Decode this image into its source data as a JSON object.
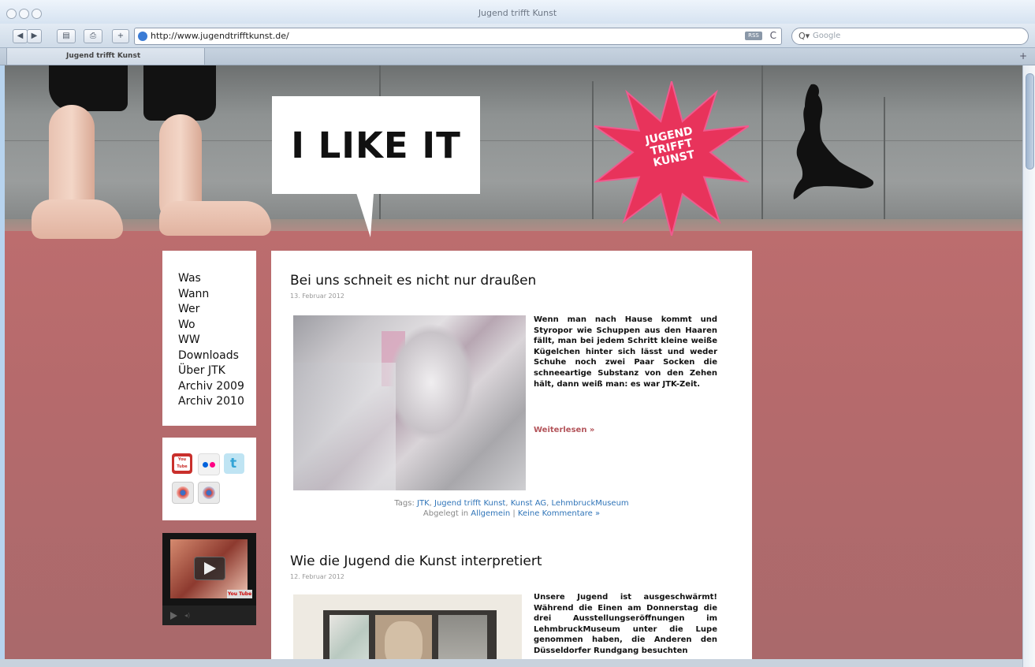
{
  "window": {
    "title": "Jugend trifft Kunst"
  },
  "toolbar": {
    "back_label": "◀",
    "forward_label": "▶",
    "url": "http://www.jugendtrifftkunst.de/",
    "rss_label": "RSS",
    "reload_label": "C",
    "search_placeholder": "Google",
    "search_prefix": "Q▾"
  },
  "tab": {
    "label": "Jugend trifft Kunst"
  },
  "header": {
    "bubble_text": "I LIKE IT",
    "star_lines": [
      "JUGEND",
      "TRIFFT",
      "KUNST"
    ]
  },
  "nav": {
    "items": [
      "Was",
      "Wann",
      "Wer",
      "Wo",
      "WW",
      "Downloads",
      "Über JTK",
      "Archiv 2009",
      "Archiv 2010"
    ]
  },
  "social": {
    "icons": [
      "youtube-icon",
      "flickr-icon",
      "twitter-icon",
      "badge-icon",
      "badge-icon"
    ],
    "youtube_label": "You Tube"
  },
  "video": {
    "label": "You Tube"
  },
  "posts": [
    {
      "title": "Bei uns schneit es nicht nur draußen",
      "date": "13. Februar 2012",
      "text": "Wenn man nach Hause kommt und Styropor wie Schuppen aus den Haaren fällt, man bei jedem Schritt kleine weiße Kügelchen hinter sich lässt und weder Schuhe noch zwei Paar Socken die schneeartige Substanz von den Zehen hält, dann weiß man: es war JTK-Zeit.",
      "more": "Weiterlesen »",
      "tags_label": "Tags:",
      "tags": [
        "JTK",
        "Jugend trifft Kunst",
        "Kunst AG",
        "LehmbruckMuseum"
      ],
      "filed_label": "Abgelegt in",
      "category": "Allgemein",
      "separator": "|",
      "comments": "Keine Kommentare »"
    },
    {
      "title": "Wie die Jugend die Kunst interpretiert",
      "date": "12. Februar 2012",
      "text": "Unsere Jugend ist ausgeschwärmt! Während die Einen am Donnerstag die drei Ausstellungseröffnungen im LehmbruckMuseum unter die Lupe genommen haben, die Anderen den Düsseldorfer Rundgang besuchten"
    }
  ]
}
